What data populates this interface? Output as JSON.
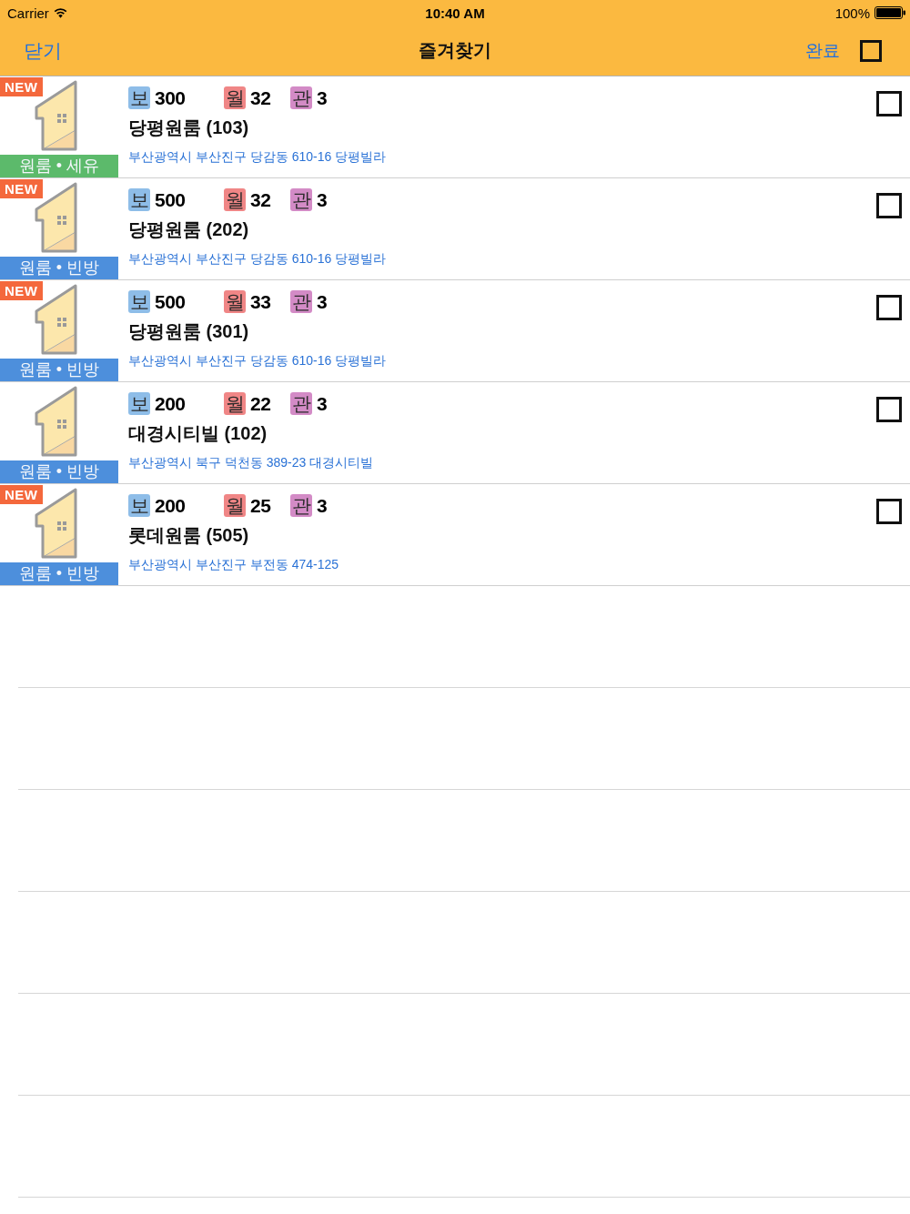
{
  "status_bar": {
    "carrier": "Carrier",
    "time": "10:40 AM",
    "battery": "100%"
  },
  "nav": {
    "close": "닫기",
    "title": "즐겨찾기",
    "done": "완료",
    "select_all": {
      "checked": false
    }
  },
  "listings": [
    {
      "badge": "NEW",
      "type": "원룸 • 세유",
      "color": "#5cba6b",
      "prices": [
        {
          "kind": "deposit",
          "label": "보",
          "value": "300",
          "color": "#8ebde8"
        },
        {
          "kind": "monthly",
          "label": "월",
          "value": "32",
          "color": "#f08686"
        },
        {
          "kind": "fee",
          "label": "관",
          "value": "3",
          "color": "#d38bc6"
        }
      ],
      "name": "당평원룸 (103)",
      "address": "부산광역시 부산진구 당감동 610-16 당평빌라",
      "checked": false
    },
    {
      "badge": "NEW",
      "type": "원룸 • 빈방",
      "color": "#4d8fdc",
      "prices": [
        {
          "kind": "deposit",
          "label": "보",
          "value": "500",
          "color": "#8ebde8"
        },
        {
          "kind": "monthly",
          "label": "월",
          "value": "32",
          "color": "#f08686"
        },
        {
          "kind": "fee",
          "label": "관",
          "value": "3",
          "color": "#d38bc6"
        }
      ],
      "name": "당평원룸 (202)",
      "address": "부산광역시 부산진구 당감동 610-16 당평빌라",
      "checked": false
    },
    {
      "badge": "NEW",
      "type": "원룸 • 빈방",
      "color": "#4d8fdc",
      "prices": [
        {
          "kind": "deposit",
          "label": "보",
          "value": "500",
          "color": "#8ebde8"
        },
        {
          "kind": "monthly",
          "label": "월",
          "value": "33",
          "color": "#f08686"
        },
        {
          "kind": "fee",
          "label": "관",
          "value": "3",
          "color": "#d38bc6"
        }
      ],
      "name": "당평원룸 (301)",
      "address": "부산광역시 부산진구 당감동 610-16 당평빌라",
      "checked": false
    },
    {
      "type": "원룸 • 빈방",
      "color": "#4d8fdc",
      "prices": [
        {
          "kind": "deposit",
          "label": "보",
          "value": "200",
          "color": "#8ebde8"
        },
        {
          "kind": "monthly",
          "label": "월",
          "value": "22",
          "color": "#f08686"
        },
        {
          "kind": "fee",
          "label": "관",
          "value": "3",
          "color": "#d38bc6"
        }
      ],
      "name": "대경시티빌 (102)",
      "address": "부산광역시 북구 덕천동 389-23 대경시티빌",
      "checked": false
    },
    {
      "badge": "NEW",
      "type": "원룸 • 빈방",
      "color": "#4d8fdc",
      "prices": [
        {
          "kind": "deposit",
          "label": "보",
          "value": "200",
          "color": "#8ebde8"
        },
        {
          "kind": "monthly",
          "label": "월",
          "value": "25",
          "color": "#f08686"
        },
        {
          "kind": "fee",
          "label": "관",
          "value": "3",
          "color": "#d38bc6"
        }
      ],
      "name": "롯데원룸 (505)",
      "address": "부산광역시 부산진구 부전동 474-125",
      "checked": false
    }
  ]
}
